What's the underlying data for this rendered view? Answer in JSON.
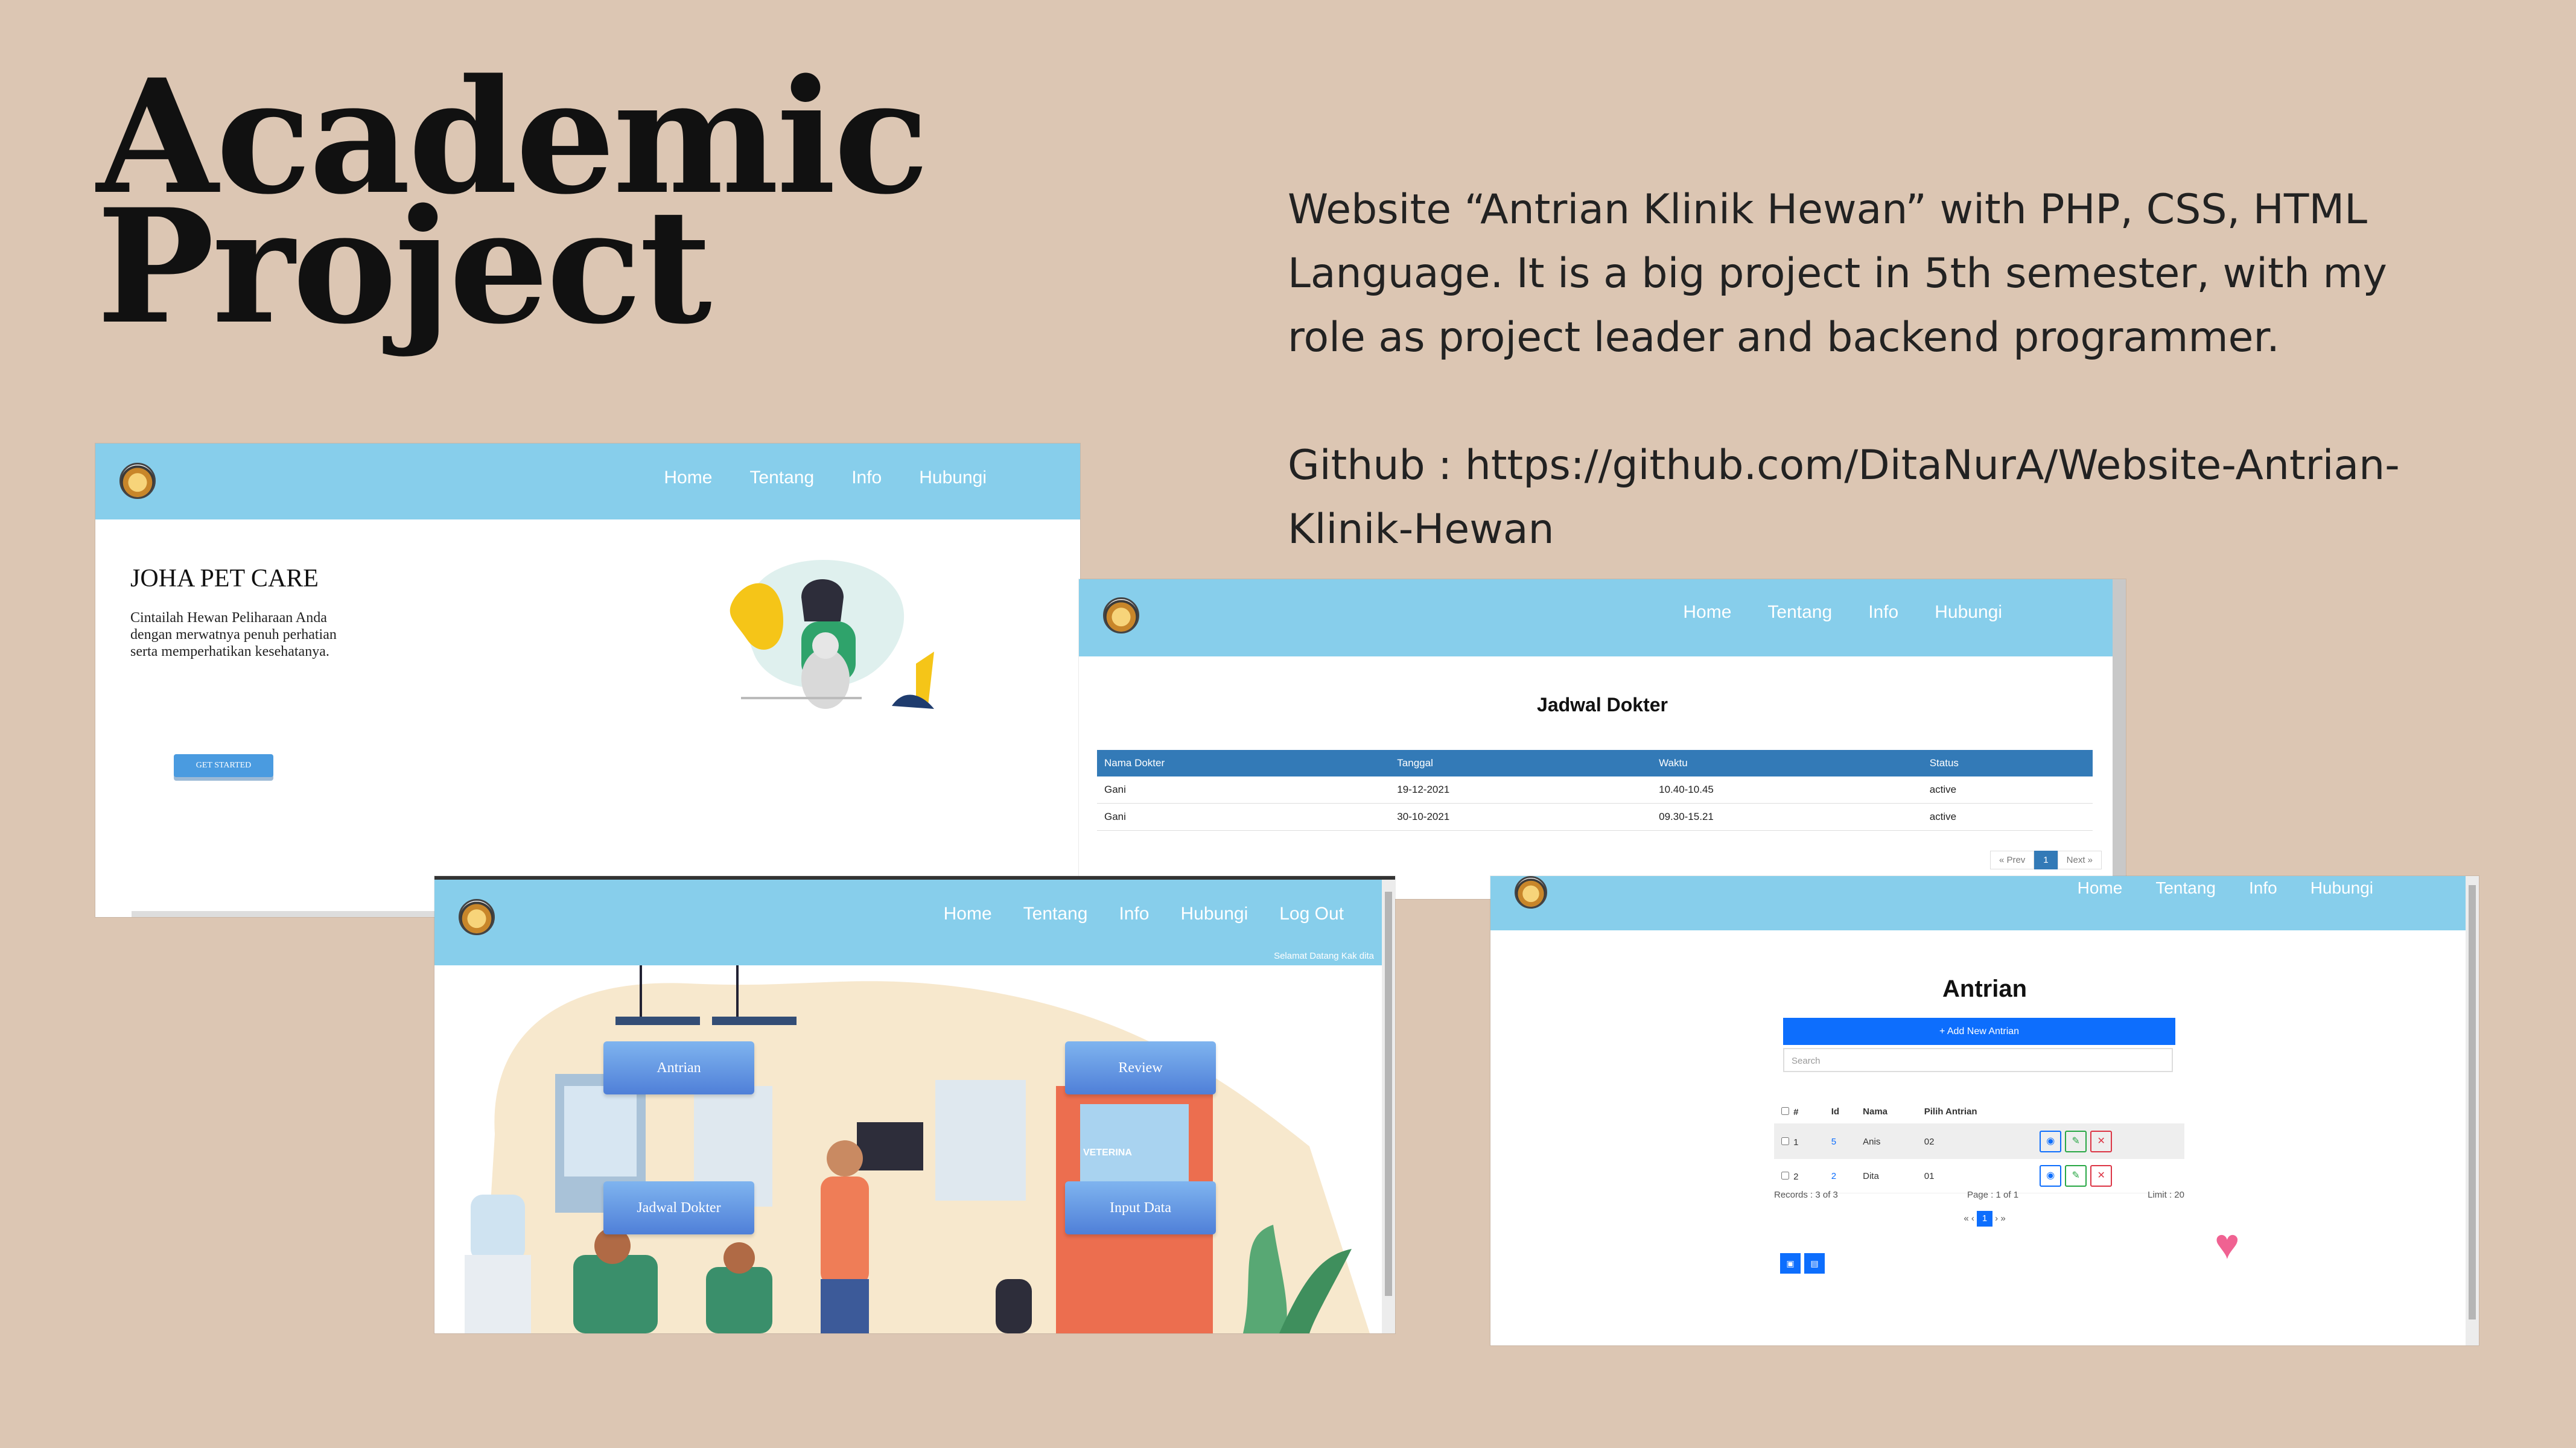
{
  "slide": {
    "title_line1": "Academic",
    "title_line2": "Project",
    "description": "Website “Antrian Klinik Hewan” with PHP, CSS, HTML Language. It is a big project in 5th semester, with my role as project leader and backend programmer.",
    "github": "Github : https://github.com/DitaNurA/Website-Antrian-Klinik-Hewan"
  },
  "colors": {
    "background": "#dcc6b3",
    "navbar": "#87ceeb",
    "primary_blue": "#0d6efd",
    "table_header": "#337ab7"
  },
  "shot1": {
    "nav": [
      "Home",
      "Tentang",
      "Info",
      "Hubungi"
    ],
    "brand": "JOHA PET CARE",
    "tagline": "Cintailah Hewan Peliharaan Anda dengan merwatnya penuh perhatian serta memperhatikan kesehatanya.",
    "cta": "GET STARTED"
  },
  "shot2": {
    "nav": [
      "Home",
      "Tentang",
      "Info",
      "Hubungi"
    ],
    "title": "Jadwal Dokter",
    "columns": [
      "Nama Dokter",
      "Tanggal",
      "Waktu",
      "Status"
    ],
    "rows": [
      [
        "Gani",
        "19-12-2021",
        "10.40-10.45",
        "active"
      ],
      [
        "Gani",
        "30-10-2021",
        "09.30-15.21",
        "active"
      ]
    ],
    "pager": [
      "« Prev",
      "1",
      "Next »"
    ]
  },
  "shot3": {
    "nav": [
      "Home",
      "Tentang",
      "Info",
      "Hubungi",
      "Log Out"
    ],
    "welcome": "Selamat Datang Kak dita",
    "buttons": [
      "Antrian",
      "Review",
      "Jadwal Dokter",
      "Input Data"
    ],
    "sign_text": "VETERINA"
  },
  "shot4": {
    "nav": [
      "Home",
      "Tentang",
      "Info",
      "Hubungi"
    ],
    "title": "Antrian",
    "add_button": "+ Add New Antrian",
    "search_placeholder": "Search",
    "columns": [
      "#",
      "Id",
      "Nama",
      "Pilih Antrian"
    ],
    "rows": [
      {
        "num": "1",
        "id": "5",
        "nama": "Anis",
        "pilih": "02"
      },
      {
        "num": "2",
        "id": "2",
        "nama": "Dita",
        "pilih": "01"
      }
    ],
    "records": "Records : 3 of 3",
    "page_label": "Page :",
    "page_value": "1",
    "page_of": "of 1",
    "limit_label": "Limit :",
    "limit_value": "20",
    "pagination": [
      "«",
      "‹",
      "1",
      "›",
      "»"
    ]
  }
}
